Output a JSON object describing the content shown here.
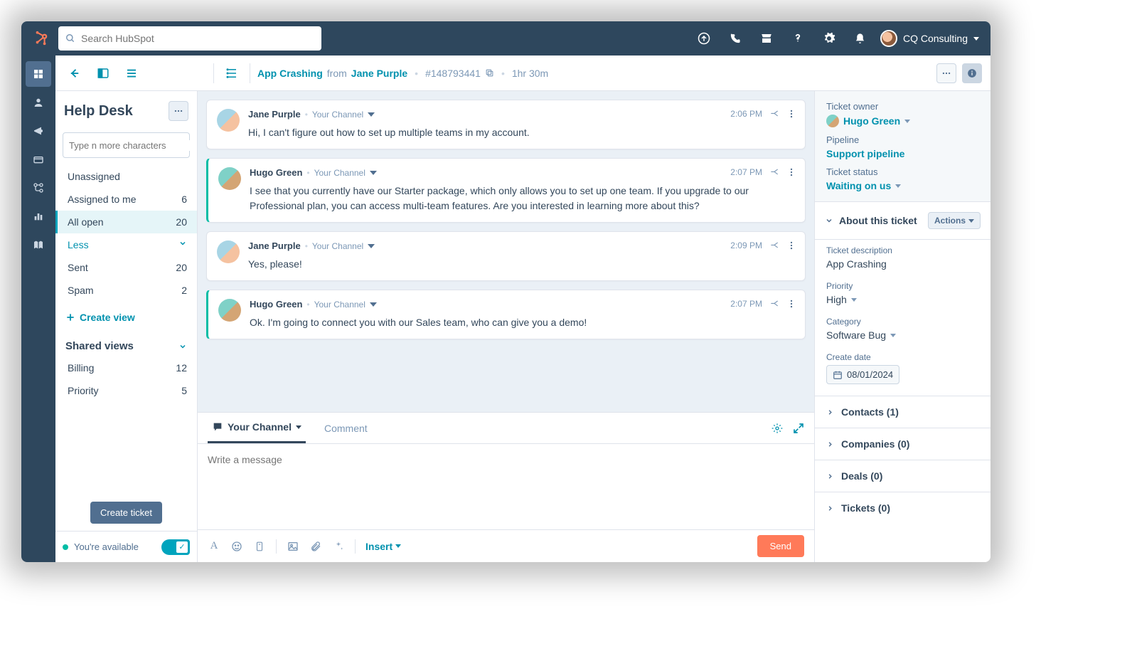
{
  "topnav": {
    "search_placeholder": "Search HubSpot",
    "account_name": "CQ Consulting"
  },
  "subheader": {
    "ticket_title": "App Crashing",
    "from_label": "from",
    "contact_name": "Jane Purple",
    "ticket_id": "#148793441",
    "duration": "1hr 30m"
  },
  "sidebar": {
    "title": "Help Desk",
    "search_placeholder": "Type n more characters",
    "views": {
      "unassigned": {
        "label": "Unassigned",
        "count": ""
      },
      "assigned_to_me": {
        "label": "Assigned to me",
        "count": "6"
      },
      "all_open": {
        "label": "All open",
        "count": "20"
      },
      "less": {
        "label": "Less"
      },
      "sent": {
        "label": "Sent",
        "count": "20"
      },
      "spam": {
        "label": "Spam",
        "count": "2"
      }
    },
    "create_view": "Create view",
    "shared_views_label": "Shared views",
    "shared_views": {
      "billing": {
        "label": "Billing",
        "count": "12"
      },
      "priority": {
        "label": "Priority",
        "count": "5"
      }
    },
    "create_ticket": "Create ticket",
    "status_text": "You're available"
  },
  "messages": [
    {
      "author": "Jane Purple",
      "channel": "Your Channel",
      "time": "2:06 PM",
      "text": "Hi, I can't figure out how to set up multiple teams in my account.",
      "agent": false
    },
    {
      "author": "Hugo Green",
      "channel": "Your Channel",
      "time": "2:07 PM",
      "text": "I see that you currently have our Starter package, which only allows you to set up one team. If you upgrade to our Professional plan, you can access multi-team features. Are you interested in learning more about this?",
      "agent": true
    },
    {
      "author": "Jane Purple",
      "channel": "Your Channel",
      "time": "2:09 PM",
      "text": "Yes, please!",
      "agent": false
    },
    {
      "author": "Hugo Green",
      "channel": "Your Channel",
      "time": "2:07 PM",
      "text": "Ok. I'm going to connect you with our Sales team, who can give you a demo!",
      "agent": true
    }
  ],
  "composer": {
    "channel_tab": "Your Channel",
    "comment_tab": "Comment",
    "placeholder": "Write a message",
    "insert_label": "Insert",
    "send_label": "Send"
  },
  "rightpanel": {
    "owner_label": "Ticket owner",
    "owner_value": "Hugo Green",
    "pipeline_label": "Pipeline",
    "pipeline_value": "Support pipeline",
    "status_label": "Ticket status",
    "status_value": "Waiting on us",
    "about_label": "About this ticket",
    "actions_label": "Actions",
    "desc_label": "Ticket description",
    "desc_value": "App Crashing",
    "priority_label": "Priority",
    "priority_value": "High",
    "category_label": "Category",
    "category_value": "Software Bug",
    "createdate_label": "Create date",
    "createdate_value": "08/01/2024",
    "contacts": "Contacts (1)",
    "companies": "Companies (0)",
    "deals": "Deals (0)",
    "tickets": "Tickets (0)"
  }
}
